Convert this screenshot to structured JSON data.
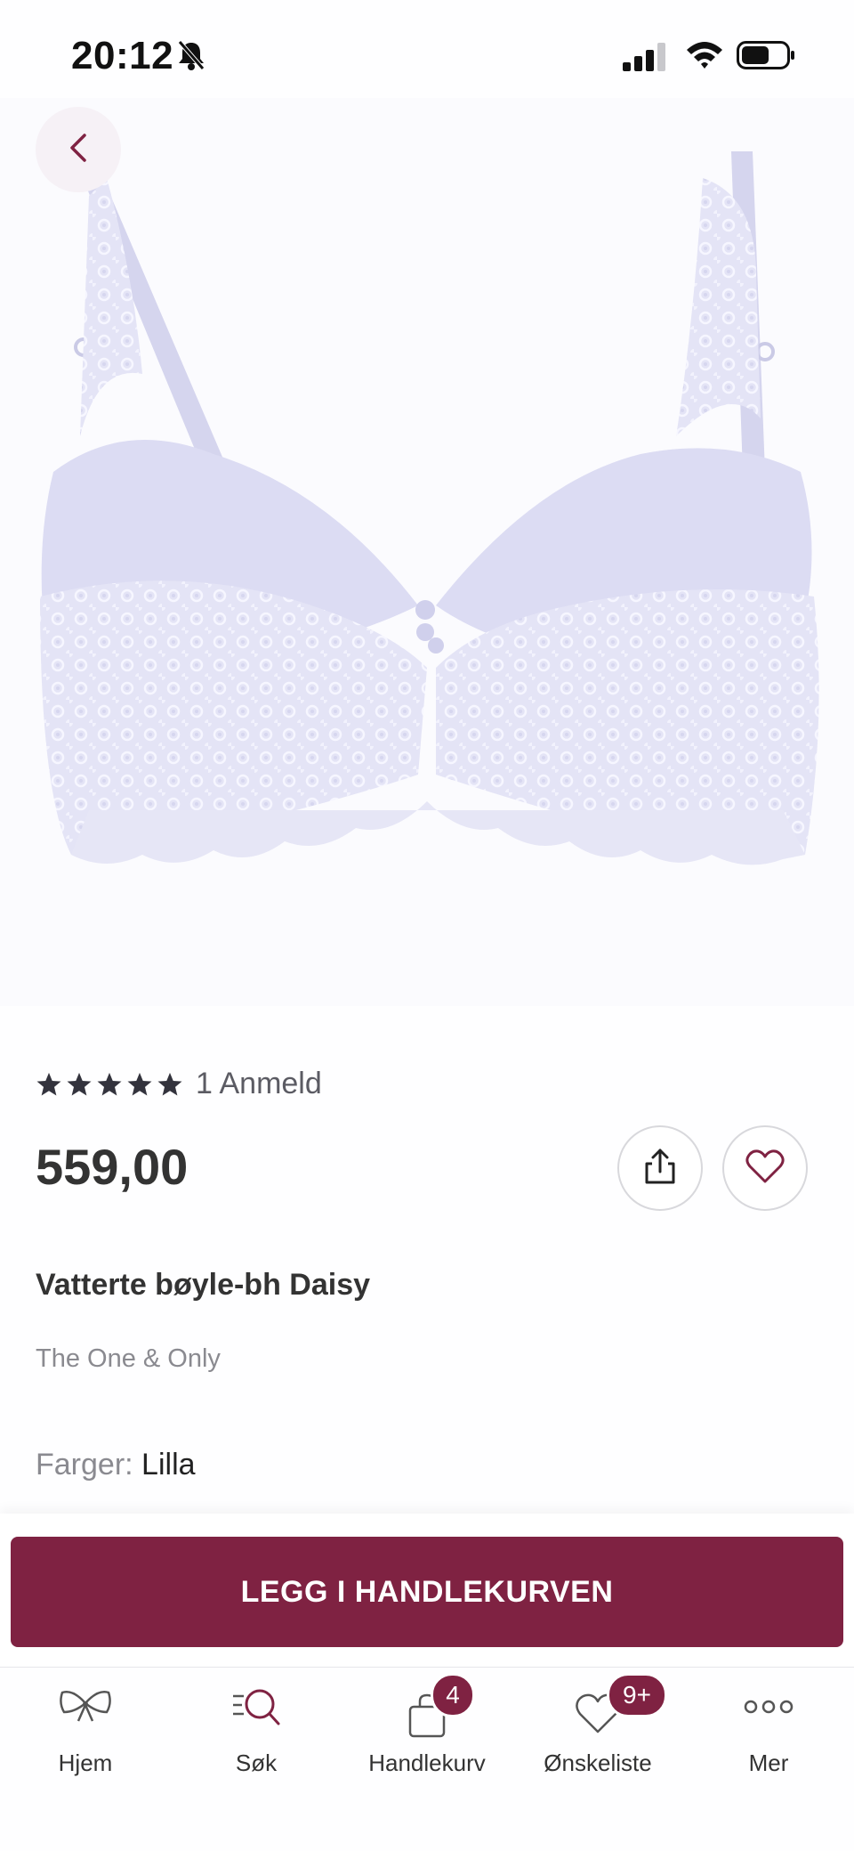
{
  "status_bar": {
    "time": "20:12"
  },
  "product": {
    "rating_stars": 5,
    "review_count_label": "1 Anmeld",
    "price": "559,00",
    "name": "Vatterte bøyle-bh Daisy",
    "brand": "The One & Only",
    "colors_label": "Farger:",
    "color_value": "Lilla"
  },
  "actions": {
    "add_to_cart": "LEGG I HANDLEKURVEN"
  },
  "nav": {
    "items": [
      {
        "label": "Hjem",
        "icon": "bow-icon"
      },
      {
        "label": "Søk",
        "icon": "search-icon"
      },
      {
        "label": "Handlekurv",
        "icon": "bag-icon",
        "badge": "4"
      },
      {
        "label": "Ønskeliste",
        "icon": "heart-icon",
        "badge": "9+"
      },
      {
        "label": "Mer",
        "icon": "more-icon"
      }
    ]
  },
  "colors": {
    "accent": "#7f2242",
    "text": "#333333",
    "muted": "#8a8a90"
  }
}
